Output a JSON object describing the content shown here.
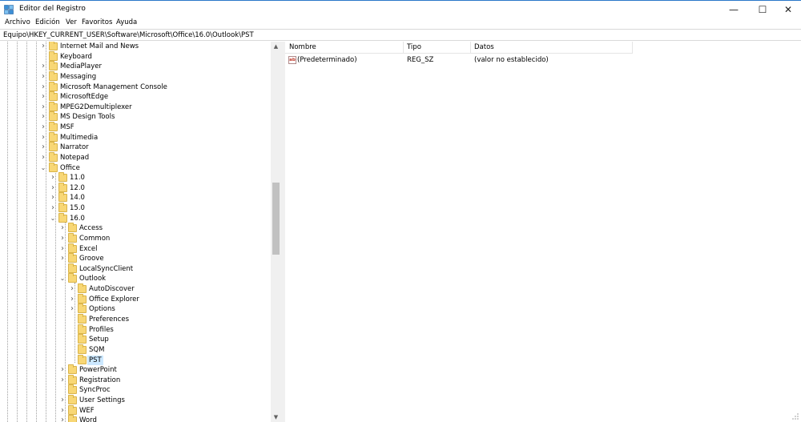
{
  "window": {
    "title": "Editor del Registro",
    "minimize_glyph": "—",
    "maximize_glyph": "☐",
    "close_glyph": "✕"
  },
  "menu": [
    "Archivo",
    "Edición",
    "Ver",
    "Favoritos",
    "Ayuda"
  ],
  "address": "Equipo\\HKEY_CURRENT_USER\\Software\\Microsoft\\Office\\16.0\\Outlook\\PST",
  "tree": [
    {
      "label": "Internet Mail and News",
      "depth": 0,
      "expander": "collapsed"
    },
    {
      "label": "Keyboard",
      "depth": 0,
      "expander": "none"
    },
    {
      "label": "MediaPlayer",
      "depth": 0,
      "expander": "collapsed"
    },
    {
      "label": "Messaging",
      "depth": 0,
      "expander": "collapsed"
    },
    {
      "label": "Microsoft Management Console",
      "depth": 0,
      "expander": "collapsed"
    },
    {
      "label": "MicrosoftEdge",
      "depth": 0,
      "expander": "collapsed"
    },
    {
      "label": "MPEG2Demultiplexer",
      "depth": 0,
      "expander": "collapsed"
    },
    {
      "label": "MS Design Tools",
      "depth": 0,
      "expander": "collapsed"
    },
    {
      "label": "MSF",
      "depth": 0,
      "expander": "collapsed"
    },
    {
      "label": "Multimedia",
      "depth": 0,
      "expander": "collapsed"
    },
    {
      "label": "Narrator",
      "depth": 0,
      "expander": "collapsed"
    },
    {
      "label": "Notepad",
      "depth": 0,
      "expander": "collapsed"
    },
    {
      "label": "Office",
      "depth": 0,
      "expander": "expanded"
    },
    {
      "label": "11.0",
      "depth": 1,
      "expander": "collapsed"
    },
    {
      "label": "12.0",
      "depth": 1,
      "expander": "collapsed"
    },
    {
      "label": "14.0",
      "depth": 1,
      "expander": "collapsed"
    },
    {
      "label": "15.0",
      "depth": 1,
      "expander": "collapsed"
    },
    {
      "label": "16.0",
      "depth": 1,
      "expander": "expanded"
    },
    {
      "label": "Access",
      "depth": 2,
      "expander": "collapsed"
    },
    {
      "label": "Common",
      "depth": 2,
      "expander": "collapsed"
    },
    {
      "label": "Excel",
      "depth": 2,
      "expander": "collapsed"
    },
    {
      "label": "Groove",
      "depth": 2,
      "expander": "collapsed"
    },
    {
      "label": "LocalSyncClient",
      "depth": 2,
      "expander": "none"
    },
    {
      "label": "Outlook",
      "depth": 2,
      "expander": "expanded"
    },
    {
      "label": "AutoDiscover",
      "depth": 3,
      "expander": "collapsed"
    },
    {
      "label": "Office Explorer",
      "depth": 3,
      "expander": "collapsed"
    },
    {
      "label": "Options",
      "depth": 3,
      "expander": "collapsed"
    },
    {
      "label": "Preferences",
      "depth": 3,
      "expander": "none"
    },
    {
      "label": "Profiles",
      "depth": 3,
      "expander": "none"
    },
    {
      "label": "Setup",
      "depth": 3,
      "expander": "none"
    },
    {
      "label": "SQM",
      "depth": 3,
      "expander": "none"
    },
    {
      "label": "PST",
      "depth": 3,
      "expander": "none",
      "selected": true
    },
    {
      "label": "PowerPoint",
      "depth": 2,
      "expander": "collapsed"
    },
    {
      "label": "Registration",
      "depth": 2,
      "expander": "collapsed"
    },
    {
      "label": "SyncProc",
      "depth": 2,
      "expander": "none"
    },
    {
      "label": "User Settings",
      "depth": 2,
      "expander": "collapsed"
    },
    {
      "label": "WEF",
      "depth": 2,
      "expander": "collapsed"
    },
    {
      "label": "Word",
      "depth": 2,
      "expander": "collapsed"
    }
  ],
  "list": {
    "columns": [
      "Nombre",
      "Tipo",
      "Datos"
    ],
    "rows": [
      {
        "name": "(Predeterminado)",
        "type": "REG_SZ",
        "data": "(valor no establecido)",
        "icon": "string-value-icon",
        "icon_text": "ab"
      }
    ]
  },
  "colors": {
    "selection": "#cce8ff",
    "folder": "#f8d775",
    "title_accent": "#2a78c9"
  }
}
